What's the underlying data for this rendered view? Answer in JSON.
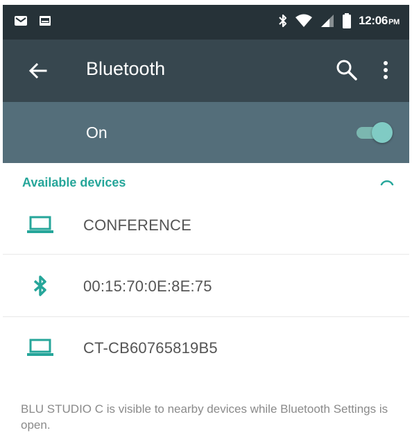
{
  "status_bar": {
    "time": "12:06",
    "ampm": "PM",
    "icons": [
      "email-icon",
      "image-icon",
      "bluetooth-icon",
      "wifi-icon",
      "signal-icon",
      "battery-icon"
    ]
  },
  "toolbar": {
    "title": "Bluetooth",
    "icons": [
      "back-arrow-icon",
      "search-icon",
      "more-vert-icon"
    ]
  },
  "switch": {
    "label": "On",
    "state": "on"
  },
  "devices_section": {
    "header": "Available devices",
    "items": [
      {
        "name": "CONFERENCE",
        "icon": "laptop-icon"
      },
      {
        "name": "00:15:70:0E:8E:75",
        "icon": "bluetooth-icon"
      },
      {
        "name": "CT-CB60765819B5",
        "icon": "laptop-icon"
      }
    ]
  },
  "footer": {
    "note": "BLU STUDIO C is visible to nearby devices while Bluetooth Settings is open."
  },
  "colors": {
    "status_bar": "#263238",
    "toolbar": "#37474f",
    "switch_bar": "#546e7a",
    "accent": "#26a69a"
  }
}
